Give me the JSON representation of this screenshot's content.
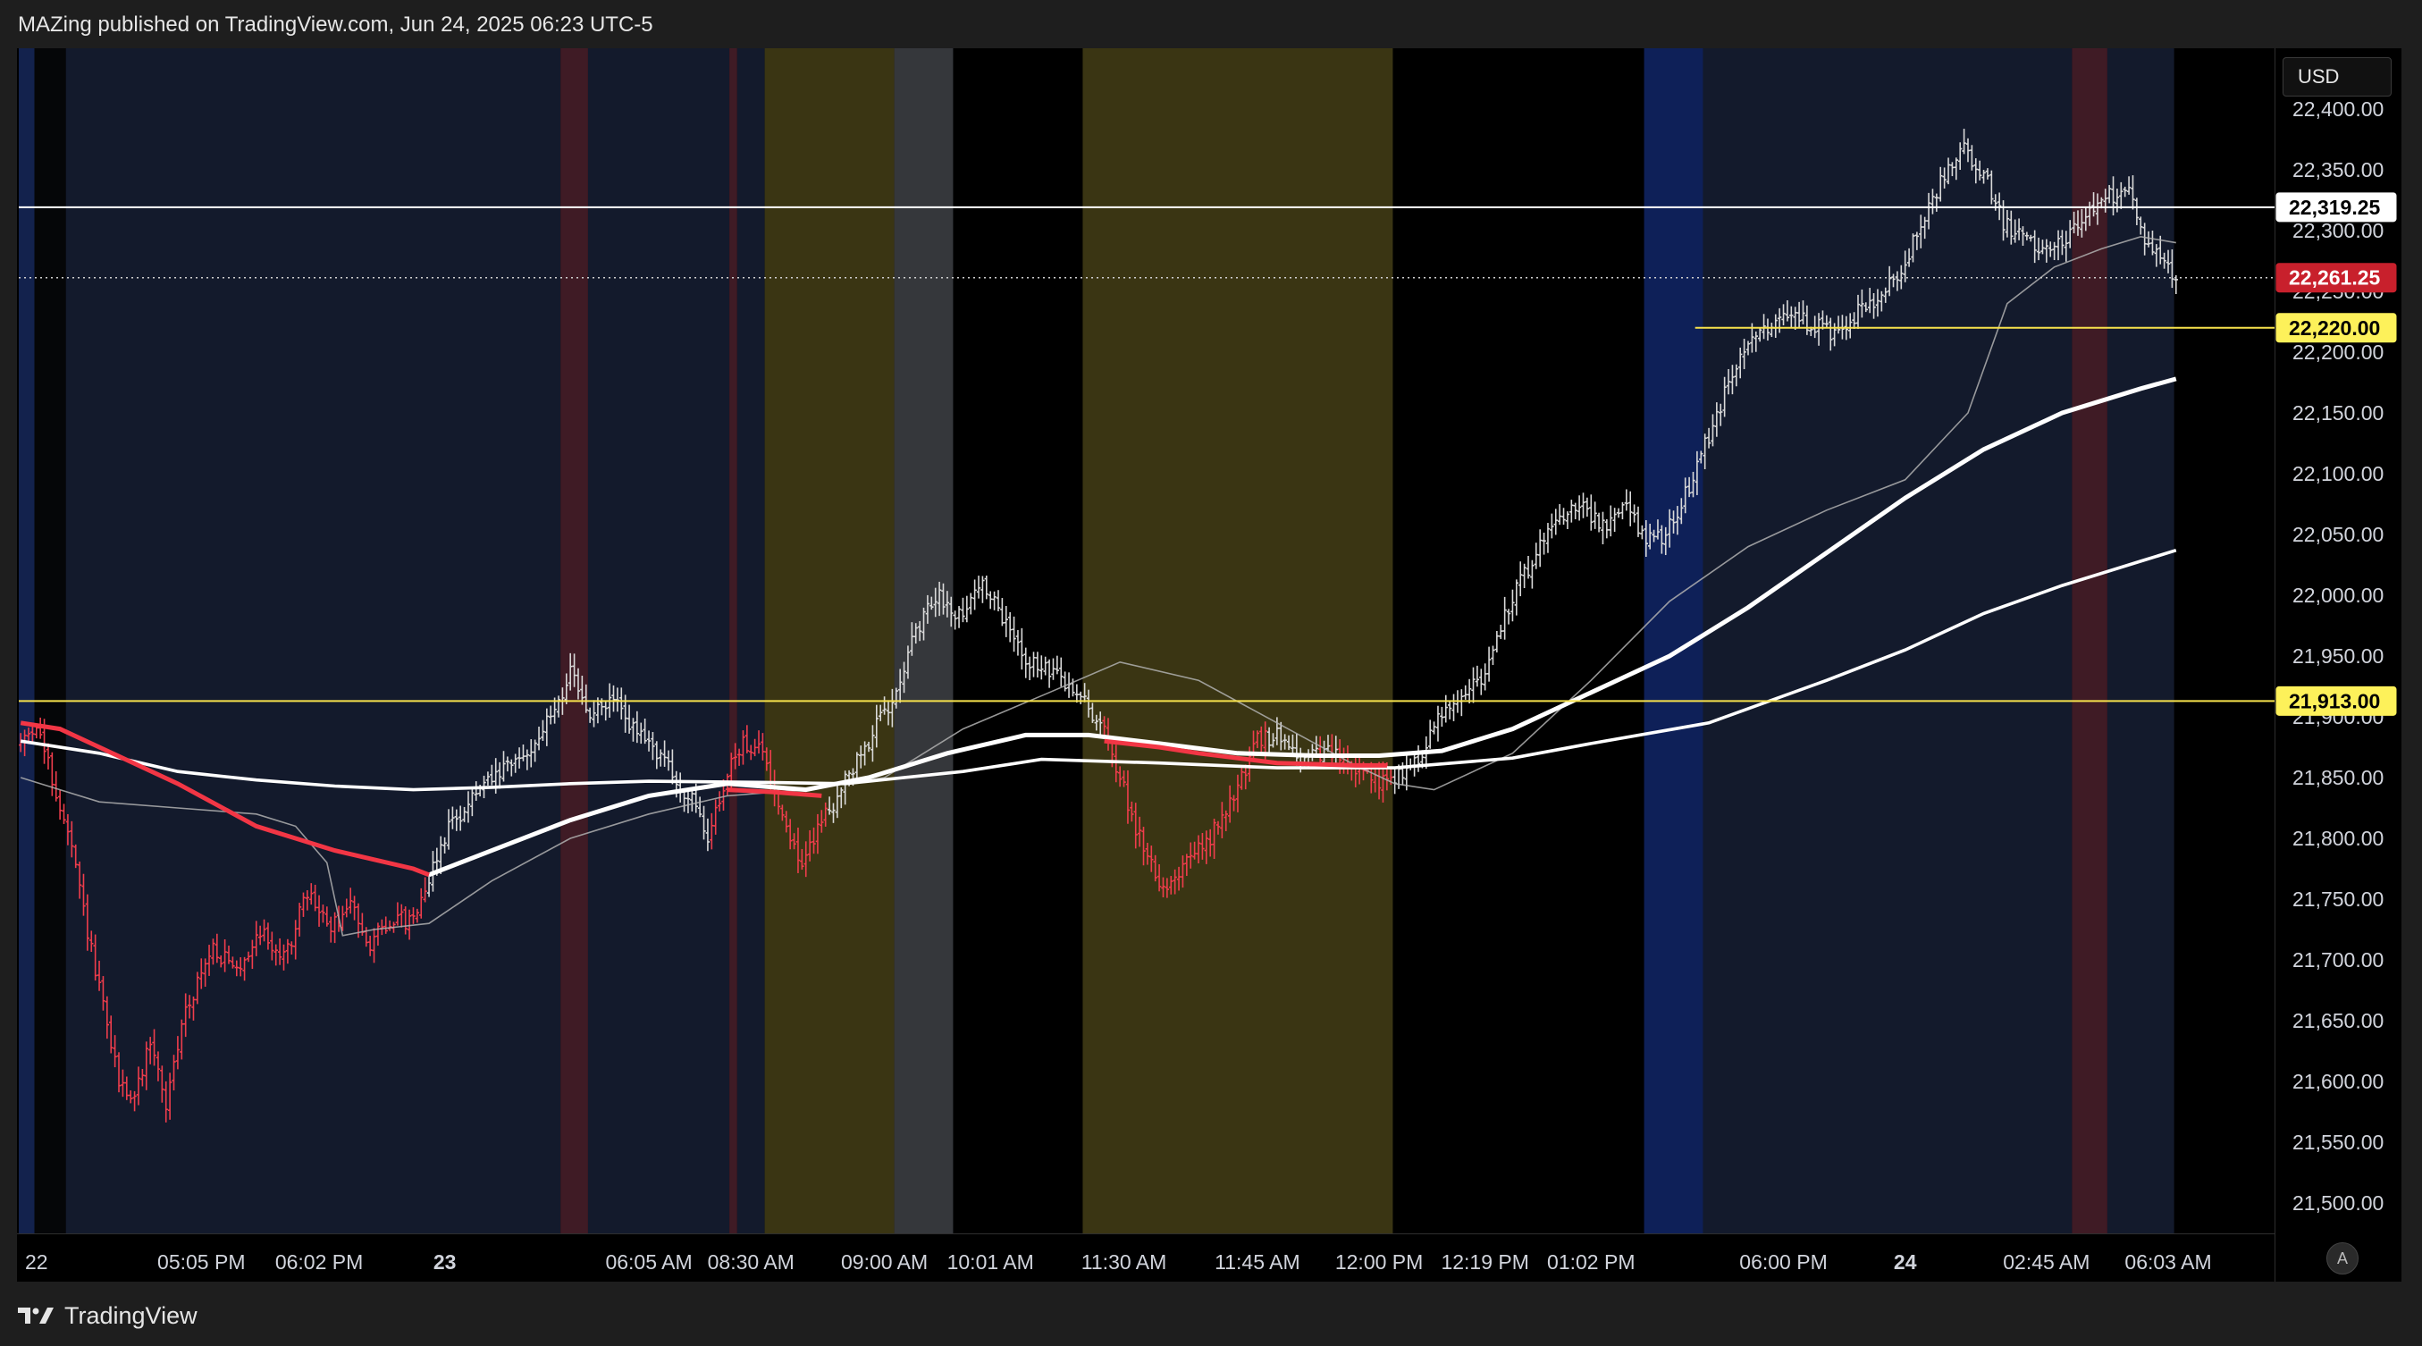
{
  "header": {
    "text": "MAZing published on TradingView.com, Jun 24, 2025 06:23 UTC-5"
  },
  "footer": {
    "brand": "TradingView",
    "icon": "tradingview-logo-icon"
  },
  "controls": {
    "currency": "USD",
    "auto_scale": "A"
  },
  "colors": {
    "background": "#000000",
    "session_blue": "#131a2c",
    "session_olive": "#3a3513",
    "session_gray": "#35373b",
    "session_maroon": "#3f1b25",
    "session_royal": "#0e2058",
    "bull_candle": "#d9d9d9",
    "bear_candle": "#ef3d4c",
    "ma_fast": "#ffffff",
    "ma_mid": "#ffffff",
    "ma_slow_bear": "#f23645",
    "ma_gray": "#b0b0b0",
    "level_white": "#ffffff",
    "level_yellow": "#f7e24c",
    "price_label_red": "#c8202c"
  },
  "chart_data": {
    "type": "candlestick",
    "symbol_currency": "USD",
    "y_range": [
      21475,
      22450
    ],
    "y_ticks": [
      "22,400.00",
      "22,350.00",
      "22,300.00",
      "22,250.00",
      "22,200.00",
      "22,150.00",
      "22,100.00",
      "22,050.00",
      "22,000.00",
      "21,950.00",
      "21,900.00",
      "21,850.00",
      "21,800.00",
      "21,750.00",
      "21,700.00",
      "21,650.00",
      "21,600.00",
      "21,550.00",
      "21,500.00"
    ],
    "x_labels": [
      {
        "label": "22",
        "bar": 4,
        "bold": false
      },
      {
        "label": "05:05 PM",
        "bar": 46,
        "bold": false
      },
      {
        "label": "06:02 PM",
        "bar": 76,
        "bold": false
      },
      {
        "label": "23",
        "bar": 108,
        "bold": true
      },
      {
        "label": "06:05 AM",
        "bar": 160,
        "bold": false
      },
      {
        "label": "08:30 AM",
        "bar": 186,
        "bold": false
      },
      {
        "label": "09:00 AM",
        "bar": 220,
        "bold": false
      },
      {
        "label": "10:01 AM",
        "bar": 247,
        "bold": false
      },
      {
        "label": "11:30 AM",
        "bar": 281,
        "bold": false
      },
      {
        "label": "11:45 AM",
        "bar": 315,
        "bold": false
      },
      {
        "label": "12:00 PM",
        "bar": 346,
        "bold": false
      },
      {
        "label": "12:19 PM",
        "bar": 373,
        "bold": false
      },
      {
        "label": "01:02 PM",
        "bar": 400,
        "bold": false
      },
      {
        "label": "06:00 PM",
        "bar": 449,
        "bold": false
      },
      {
        "label": "24",
        "bar": 480,
        "bold": true
      },
      {
        "label": "02:45 AM",
        "bar": 516,
        "bold": false
      },
      {
        "label": "06:03 AM",
        "bar": 547,
        "bold": false
      }
    ],
    "price_tags": [
      {
        "label": "22,319.25",
        "value": 22319.25,
        "style": "white"
      },
      {
        "label": "22,261.25",
        "value": 22261.25,
        "style": "red"
      },
      {
        "label": "22,220.00",
        "value": 22220,
        "style": "yellow"
      },
      {
        "label": "21,913.00",
        "value": 21913,
        "style": "yellow"
      }
    ],
    "levels": [
      {
        "value": 22319.25,
        "color": "#ffffff",
        "from_bar": 0,
        "width": 2,
        "dash": ""
      },
      {
        "value": 22261.25,
        "color": "#d0d0d0",
        "from_bar": 0,
        "width": 1.5,
        "dash": "2,4"
      },
      {
        "value": 22220,
        "color": "#f7e24c",
        "from_bar": 427,
        "width": 2,
        "dash": ""
      },
      {
        "value": 21913,
        "color": "#f7e24c",
        "from_bar": 0,
        "width": 2,
        "dash": ""
      }
    ],
    "sessions": [
      {
        "from": 0,
        "to": 4,
        "color": "#13224d"
      },
      {
        "from": 4,
        "to": 12,
        "color": "#050608"
      },
      {
        "from": 12,
        "to": 138,
        "color": "#131a2c"
      },
      {
        "from": 138,
        "to": 145,
        "color": "#3f1b25"
      },
      {
        "from": 145,
        "to": 181,
        "color": "#131a2c"
      },
      {
        "from": 181,
        "to": 183,
        "color": "#3f1b25"
      },
      {
        "from": 183,
        "to": 190,
        "color": "#131a2c"
      },
      {
        "from": 190,
        "to": 223,
        "color": "#3a3513"
      },
      {
        "from": 223,
        "to": 238,
        "color": "#35373b"
      },
      {
        "from": 238,
        "to": 271,
        "color": "#000000"
      },
      {
        "from": 271,
        "to": 350,
        "color": "#3a3513"
      },
      {
        "from": 350,
        "to": 414,
        "color": "#000000"
      },
      {
        "from": 414,
        "to": 429,
        "color": "#0e2058"
      },
      {
        "from": 429,
        "to": 523,
        "color": "#131a2c"
      },
      {
        "from": 523,
        "to": 532,
        "color": "#3f1b25"
      },
      {
        "from": 532,
        "to": 549,
        "color": "#131a2c"
      }
    ],
    "anchors": [
      [
        0,
        21875
      ],
      [
        5,
        21895
      ],
      [
        8,
        21860
      ],
      [
        14,
        21790
      ],
      [
        20,
        21690
      ],
      [
        26,
        21600
      ],
      [
        30,
        21585
      ],
      [
        34,
        21635
      ],
      [
        38,
        21580
      ],
      [
        43,
        21660
      ],
      [
        50,
        21710
      ],
      [
        56,
        21690
      ],
      [
        62,
        21725
      ],
      [
        68,
        21700
      ],
      [
        74,
        21755
      ],
      [
        80,
        21725
      ],
      [
        85,
        21745
      ],
      [
        90,
        21715
      ],
      [
        96,
        21735
      ],
      [
        100,
        21730
      ],
      [
        104,
        21760
      ],
      [
        110,
        21810
      ],
      [
        118,
        21840
      ],
      [
        124,
        21855
      ],
      [
        130,
        21870
      ],
      [
        136,
        21900
      ],
      [
        141,
        21935
      ],
      [
        146,
        21900
      ],
      [
        152,
        21915
      ],
      [
        158,
        21885
      ],
      [
        164,
        21870
      ],
      [
        168,
        21845
      ],
      [
        172,
        21830
      ],
      [
        176,
        21800
      ],
      [
        180,
        21845
      ],
      [
        185,
        21880
      ],
      [
        190,
        21870
      ],
      [
        194,
        21830
      ],
      [
        200,
        21775
      ],
      [
        204,
        21810
      ],
      [
        210,
        21840
      ],
      [
        216,
        21875
      ],
      [
        222,
        21910
      ],
      [
        228,
        21960
      ],
      [
        234,
        22000
      ],
      [
        240,
        21985
      ],
      [
        246,
        22010
      ],
      [
        252,
        21975
      ],
      [
        258,
        21945
      ],
      [
        264,
        21935
      ],
      [
        270,
        21920
      ],
      [
        276,
        21895
      ],
      [
        280,
        21860
      ],
      [
        286,
        21800
      ],
      [
        292,
        21760
      ],
      [
        298,
        21780
      ],
      [
        304,
        21800
      ],
      [
        310,
        21835
      ],
      [
        316,
        21880
      ],
      [
        322,
        21885
      ],
      [
        328,
        21865
      ],
      [
        334,
        21870
      ],
      [
        340,
        21860
      ],
      [
        346,
        21845
      ],
      [
        350,
        21850
      ],
      [
        356,
        21860
      ],
      [
        362,
        21900
      ],
      [
        368,
        21920
      ],
      [
        374,
        21935
      ],
      [
        380,
        21990
      ],
      [
        386,
        22030
      ],
      [
        392,
        22065
      ],
      [
        398,
        22075
      ],
      [
        404,
        22055
      ],
      [
        410,
        22070
      ],
      [
        416,
        22045
      ],
      [
        420,
        22050
      ],
      [
        426,
        22090
      ],
      [
        432,
        22140
      ],
      [
        438,
        22190
      ],
      [
        444,
        22215
      ],
      [
        450,
        22235
      ],
      [
        456,
        22225
      ],
      [
        462,
        22215
      ],
      [
        468,
        22230
      ],
      [
        474,
        22245
      ],
      [
        480,
        22265
      ],
      [
        484,
        22300
      ],
      [
        490,
        22340
      ],
      [
        496,
        22365
      ],
      [
        502,
        22340
      ],
      [
        506,
        22305
      ],
      [
        512,
        22295
      ],
      [
        518,
        22280
      ],
      [
        522,
        22295
      ],
      [
        528,
        22315
      ],
      [
        534,
        22330
      ],
      [
        538,
        22335
      ],
      [
        542,
        22295
      ],
      [
        546,
        22280
      ],
      [
        549,
        22260
      ]
    ],
    "ma_white_fast": [
      [
        104,
        21770
      ],
      [
        120,
        21790
      ],
      [
        140,
        21815
      ],
      [
        160,
        21835
      ],
      [
        180,
        21845
      ],
      [
        200,
        21840
      ],
      [
        216,
        21850
      ],
      [
        236,
        21870
      ],
      [
        256,
        21885
      ],
      [
        272,
        21885
      ],
      [
        290,
        21878
      ],
      [
        310,
        21870
      ],
      [
        330,
        21868
      ],
      [
        346,
        21868
      ],
      [
        362,
        21872
      ],
      [
        380,
        21890
      ],
      [
        400,
        21920
      ],
      [
        420,
        21950
      ],
      [
        440,
        21990
      ],
      [
        460,
        22035
      ],
      [
        480,
        22080
      ],
      [
        500,
        22120
      ],
      [
        520,
        22150
      ],
      [
        540,
        22170
      ],
      [
        549,
        22178
      ]
    ],
    "ma_red_seg1": [
      [
        0,
        21895
      ],
      [
        10,
        21890
      ],
      [
        20,
        21875
      ],
      [
        40,
        21845
      ],
      [
        60,
        21810
      ],
      [
        80,
        21790
      ],
      [
        100,
        21775
      ],
      [
        104,
        21770
      ]
    ],
    "ma_red_seg2": [
      [
        180,
        21840
      ],
      [
        192,
        21838
      ],
      [
        204,
        21835
      ]
    ],
    "ma_red_seg3": [
      [
        276,
        21880
      ],
      [
        290,
        21875
      ],
      [
        300,
        21870
      ],
      [
        320,
        21862
      ],
      [
        340,
        21860
      ],
      [
        348,
        21860
      ]
    ],
    "ma_white_slow": [
      [
        0,
        21880
      ],
      [
        20,
        21870
      ],
      [
        40,
        21855
      ],
      [
        60,
        21848
      ],
      [
        80,
        21843
      ],
      [
        100,
        21840
      ],
      [
        120,
        21842
      ],
      [
        140,
        21845
      ],
      [
        160,
        21847
      ],
      [
        190,
        21846
      ],
      [
        210,
        21845
      ],
      [
        240,
        21855
      ],
      [
        260,
        21865
      ],
      [
        290,
        21862
      ],
      [
        320,
        21858
      ],
      [
        350,
        21858
      ],
      [
        380,
        21866
      ],
      [
        400,
        21878
      ],
      [
        430,
        21895
      ],
      [
        460,
        21930
      ],
      [
        480,
        21955
      ],
      [
        500,
        21985
      ],
      [
        520,
        22008
      ],
      [
        540,
        22028
      ],
      [
        549,
        22037
      ]
    ],
    "ma_gray_thin": [
      [
        0,
        21850
      ],
      [
        10,
        21840
      ],
      [
        20,
        21830
      ],
      [
        40,
        21825
      ],
      [
        60,
        21820
      ],
      [
        70,
        21810
      ],
      [
        78,
        21780
      ],
      [
        82,
        21720
      ],
      [
        90,
        21725
      ],
      [
        104,
        21730
      ],
      [
        120,
        21765
      ],
      [
        140,
        21800
      ],
      [
        160,
        21820
      ],
      [
        180,
        21835
      ],
      [
        200,
        21840
      ],
      [
        220,
        21850
      ],
      [
        240,
        21890
      ],
      [
        262,
        21920
      ],
      [
        280,
        21945
      ],
      [
        300,
        21930
      ],
      [
        320,
        21895
      ],
      [
        340,
        21860
      ],
      [
        350,
        21845
      ],
      [
        360,
        21840
      ],
      [
        380,
        21870
      ],
      [
        400,
        21930
      ],
      [
        420,
        21995
      ],
      [
        440,
        22040
      ],
      [
        460,
        22070
      ],
      [
        480,
        22095
      ],
      [
        496,
        22150
      ],
      [
        506,
        22240
      ],
      [
        518,
        22270
      ],
      [
        530,
        22285
      ],
      [
        540,
        22295
      ],
      [
        549,
        22290
      ]
    ]
  }
}
